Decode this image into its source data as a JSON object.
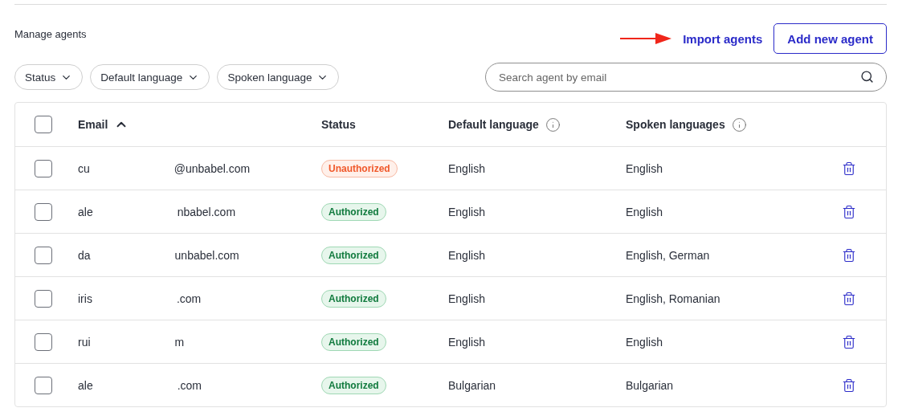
{
  "title": "Manage agents",
  "actions": {
    "import": "Import agents",
    "add": "Add new agent"
  },
  "filters": [
    {
      "label": "Status"
    },
    {
      "label": "Default language"
    },
    {
      "label": "Spoken language"
    }
  ],
  "search": {
    "placeholder": "Search agent by email"
  },
  "table": {
    "select_all": {
      "checked": false
    },
    "columns": [
      {
        "label": "Email",
        "sorted": true,
        "info": false
      },
      {
        "label": "Status",
        "sorted": false,
        "info": false
      },
      {
        "label": "Default language",
        "sorted": false,
        "info": true
      },
      {
        "label": "Spoken languages",
        "sorted": false,
        "info": true
      }
    ],
    "rows": [
      {
        "checked": false,
        "email_start": "cu",
        "email_end": "@unbabel.com",
        "status": {
          "kind": "unauthorized",
          "label": "Unauthorized"
        },
        "default_language": "English",
        "spoken_languages": "English"
      },
      {
        "checked": false,
        "email_start": "ale",
        "email_end": "nbabel.com",
        "status": {
          "kind": "authorized",
          "label": "Authorized"
        },
        "default_language": "English",
        "spoken_languages": "English"
      },
      {
        "checked": false,
        "email_start": "da",
        "email_end": "unbabel.com",
        "status": {
          "kind": "authorized",
          "label": "Authorized"
        },
        "default_language": "English",
        "spoken_languages": "English, German"
      },
      {
        "checked": false,
        "email_start": "iris",
        "email_end": ".com",
        "status": {
          "kind": "authorized",
          "label": "Authorized"
        },
        "default_language": "English",
        "spoken_languages": "English, Romanian"
      },
      {
        "checked": false,
        "email_start": "rui",
        "email_end": "m",
        "status": {
          "kind": "authorized",
          "label": "Authorized"
        },
        "default_language": "English",
        "spoken_languages": "English"
      },
      {
        "checked": false,
        "email_start": "ale",
        "email_end": ".com",
        "status": {
          "kind": "authorized",
          "label": "Authorized"
        },
        "default_language": "Bulgarian",
        "spoken_languages": "Bulgarian"
      }
    ]
  }
}
